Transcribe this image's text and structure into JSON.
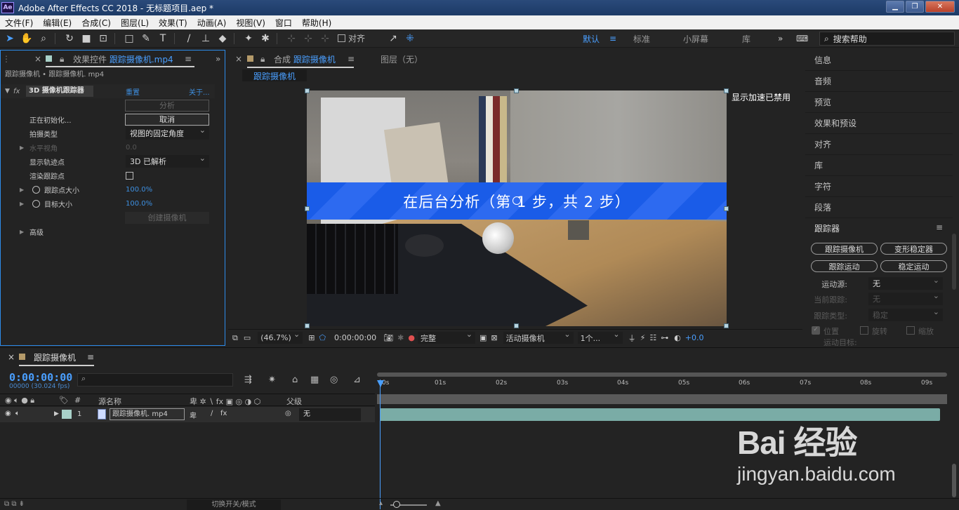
{
  "window": {
    "title": "Adobe After Effects CC 2018 - 无标题项目.aep *",
    "logo": "Ae"
  },
  "menu": [
    "文件(F)",
    "编辑(E)",
    "合成(C)",
    "图层(L)",
    "效果(T)",
    "动画(A)",
    "视图(V)",
    "窗口",
    "帮助(H)"
  ],
  "toolbar": {
    "align_label": "对齐",
    "workspaces": [
      "默认",
      "标准",
      "小屏幕",
      "库"
    ],
    "active_workspace": "默认",
    "search_placeholder": "搜索帮助"
  },
  "effect_controls": {
    "tab_prefix": "效果控件",
    "tab_layer": "跟踪摄像机.mp4",
    "breadcrumb": "跟踪摄像机 • 跟踪摄像机. mp4",
    "effect_name": "3D 摄像机跟踪器",
    "reset_label": "重置",
    "about_label": "关于...",
    "analyze_btn": "分析",
    "initializing_label": "正在初始化...",
    "cancel_btn": "取消",
    "shot_type_label": "拍摄类型",
    "shot_type_value": "视图的固定角度",
    "fov_label": "水平视角",
    "fov_value": "0.0",
    "show_track_label": "显示轨迹点",
    "show_track_value": "3D 已解析",
    "render_track_label": "渲染跟踪点",
    "track_size_label": "跟踪点大小",
    "track_size_value": "100.0%",
    "target_size_label": "目标大小",
    "target_size_value": "100.0%",
    "create_camera_btn": "创建摄像机",
    "advanced_label": "高级"
  },
  "composition": {
    "tab_prefix": "合成",
    "tab_name": "跟踪摄像机",
    "layer_tab": "图层（无）",
    "sub_tab": "跟踪摄像机",
    "accel_notice": "显示加速已禁用",
    "banner_text": "在后台分析（第 1 步，共 2 步）",
    "zoom": "(46.7%)",
    "timecode": "0:00:00:00",
    "resolution": "完整",
    "camera": "活动摄像机",
    "views": "1个...",
    "exposure": "+0.0"
  },
  "right_panels": {
    "items": [
      "信息",
      "音频",
      "预览",
      "效果和预设",
      "对齐",
      "库",
      "字符",
      "段落"
    ],
    "tracker": {
      "title": "跟踪器",
      "btn_track_camera": "跟踪摄像机",
      "btn_warp_stabilizer": "变形稳定器",
      "btn_track_motion": "跟踪运动",
      "btn_stabilize_motion": "稳定运动",
      "motion_source_label": "运动源:",
      "motion_source_value": "无",
      "current_track_label": "当前跟踪:",
      "current_track_value": "无",
      "track_type_label": "跟踪类型:",
      "track_type_value": "稳定",
      "position_label": "位置",
      "rotation_label": "旋转",
      "scale_label": "缩放",
      "motion_target_label": "运动目标:"
    }
  },
  "timeline": {
    "tab_name": "跟踪摄像机",
    "timecode": "0:00:00:00",
    "timecode_sub": "00000 (30.024 fps)",
    "search_placeholder": "⌕",
    "col_source": "源名称",
    "col_parent": "父级",
    "col_num": "#",
    "layer": {
      "index": "1",
      "name": "跟踪摄像机. mp4",
      "parent": "无"
    },
    "ticks": [
      "0s",
      "01s",
      "02s",
      "03s",
      "04s",
      "05s",
      "06s",
      "07s",
      "08s",
      "09s"
    ],
    "toggle_label": "切换开关/模式"
  },
  "watermark": {
    "main": "Bai 经验",
    "sub": "jingyan.baidu.com"
  },
  "colors": {
    "accent": "#2d8ceb",
    "banner": "#1a5ce8",
    "layer_bar": "#7aaca6"
  }
}
